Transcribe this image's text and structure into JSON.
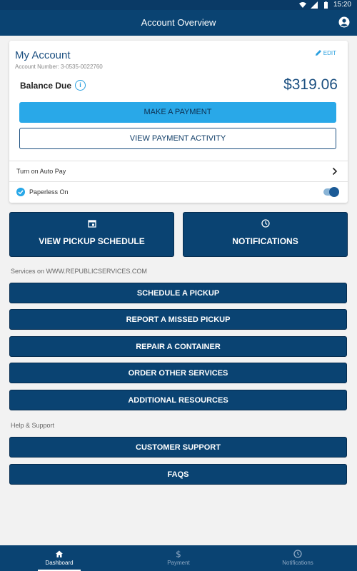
{
  "status_bar": {
    "time": "15:20"
  },
  "app_bar": {
    "title": "Account Overview"
  },
  "account_card": {
    "title": "My Account",
    "account_number": "Account Number: 3-0535-0022760",
    "edit_label": "EDIT",
    "balance_label": "Balance Due",
    "balance_amount": "$319.06",
    "make_payment_label": "MAKE A PAYMENT",
    "view_activity_label": "VIEW PAYMENT ACTIVITY",
    "auto_pay_label": "Turn on Auto Pay",
    "paperless_label": "Paperless On",
    "paperless_on": true
  },
  "tiles": {
    "pickup_label": "VIEW PICKUP SCHEDULE",
    "notifications_label": "NOTIFICATIONS"
  },
  "services": {
    "heading": "Services on WWW.REPUBLICSERVICES.COM",
    "items": [
      {
        "label": "SCHEDULE A PICKUP"
      },
      {
        "label": "REPORT A MISSED PICKUP"
      },
      {
        "label": "REPAIR A CONTAINER"
      },
      {
        "label": "ORDER OTHER SERVICES"
      },
      {
        "label": "ADDITIONAL RESOURCES"
      }
    ]
  },
  "support": {
    "heading": "Help & Support",
    "items": [
      {
        "label": "CUSTOMER SUPPORT"
      },
      {
        "label": "FAQS"
      }
    ]
  },
  "bottom_nav": {
    "items": [
      {
        "label": "Dashboard",
        "icon": "home-icon",
        "active": true
      },
      {
        "label": "Payment",
        "icon": "dollar-icon",
        "active": false
      },
      {
        "label": "Notifications",
        "icon": "clock-icon",
        "active": false
      }
    ]
  },
  "colors": {
    "primary": "#0a4372",
    "accent": "#29a8e8",
    "background": "#f2f2f2"
  }
}
